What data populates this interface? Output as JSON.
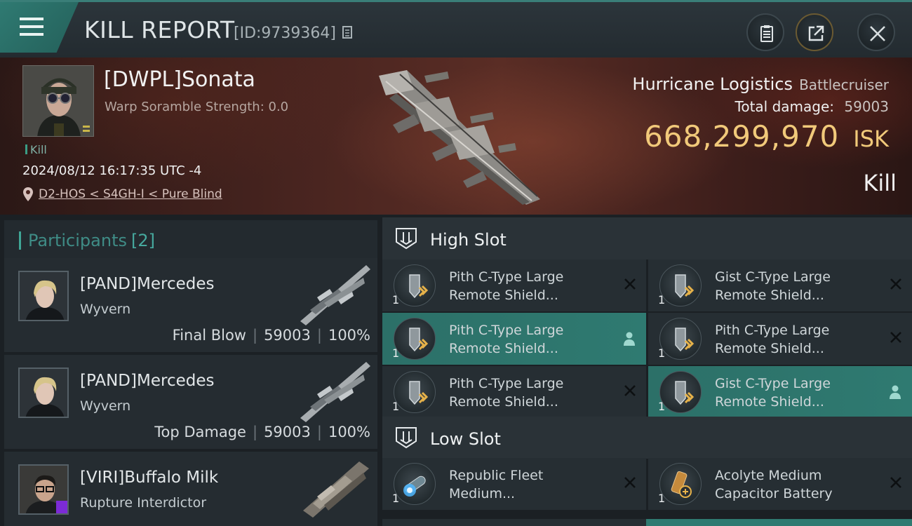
{
  "header": {
    "title": "KILL REPORT",
    "report_id": "[ID:9739364]",
    "icons": [
      "menu-icon",
      "copy-icon",
      "clipboard-icon",
      "share-icon",
      "close-icon"
    ]
  },
  "victim": {
    "name": "[DWPL]Sonata",
    "subtitle": "Warp Soramble Strength: 0.0",
    "tag": "Kill",
    "timestamp": "2024/08/12 16:17:35 UTC -4",
    "location": "D2-HOS < S4GH-I < Pure Blind",
    "ship_name": "Hurricane Logistics",
    "ship_class": "Battlecruiser",
    "total_damage_label": "Total damage:",
    "total_damage": "59003",
    "isk_value": "668,299,970",
    "isk_unit": "ISK",
    "kill_type": "Kill"
  },
  "participants": {
    "title": "Participants",
    "count": "[2]",
    "items": [
      {
        "name": "[PAND]Mercedes",
        "ship": "Wyvern",
        "role": "Final Blow",
        "damage": "59003",
        "percent": "100%"
      },
      {
        "name": "[PAND]Mercedes",
        "ship": "Wyvern",
        "role": "Top Damage",
        "damage": "59003",
        "percent": "100%"
      },
      {
        "name": "[VIRI]Buffalo Milk",
        "ship": "Rupture Interdictor",
        "role": "",
        "damage": "",
        "percent": ""
      }
    ]
  },
  "fitting": {
    "high_slot": {
      "title": "High Slot",
      "modules": [
        {
          "line1": "Pith C-Type Large",
          "line2": "Remote Shield...",
          "qty": "1",
          "status": "destroyed",
          "active": false
        },
        {
          "line1": "Gist C-Type Large",
          "line2": "Remote Shield...",
          "qty": "1",
          "status": "destroyed",
          "active": false
        },
        {
          "line1": "Pith C-Type Large",
          "line2": "Remote Shield...",
          "qty": "1",
          "status": "dropped",
          "active": true
        },
        {
          "line1": "Pith C-Type Large",
          "line2": "Remote Shield...",
          "qty": "1",
          "status": "destroyed",
          "active": false
        },
        {
          "line1": "Pith C-Type Large",
          "line2": "Remote Shield...",
          "qty": "1",
          "status": "destroyed",
          "active": false
        },
        {
          "line1": "Gist C-Type Large",
          "line2": "Remote Shield...",
          "qty": "1",
          "status": "dropped",
          "active": true
        }
      ]
    },
    "low_slot": {
      "title": "Low Slot",
      "modules": [
        {
          "line1": "Republic Fleet",
          "line2": "Medium...",
          "qty": "1",
          "status": "destroyed",
          "active": false
        },
        {
          "line1": "Acolyte Medium",
          "line2": "Capacitor Battery",
          "qty": "1",
          "status": "destroyed",
          "active": false
        }
      ]
    }
  },
  "colors": {
    "accent_teal": "#2f7a71",
    "isk_gold": "#f1c97a",
    "banner_red": "#4a2520"
  }
}
